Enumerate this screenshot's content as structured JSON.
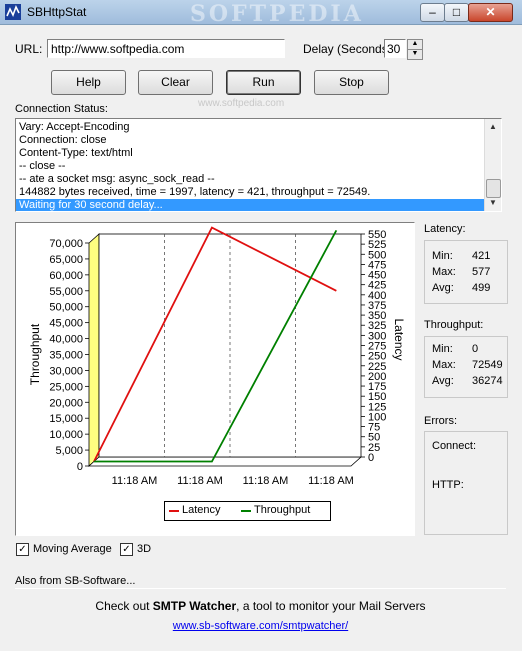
{
  "window": {
    "title": "SBHttpStat",
    "watermark": "SOFTPEDIA"
  },
  "url": {
    "label": "URL:",
    "value": "http://www.softpedia.com"
  },
  "delay": {
    "label": "Delay (Seconds):",
    "value": "30"
  },
  "buttons": {
    "help": "Help",
    "clear": "Clear",
    "run": "Run",
    "stop": "Stop"
  },
  "button_watermark": "www.softpedia.com",
  "connection": {
    "label": "Connection Status:",
    "lines": [
      "Vary: Accept-Encoding",
      "Connection: close",
      "Content-Type: text/html",
      "-- close --",
      "-- ate a socket msg: async_sock_read --",
      "144882 bytes received, time = 1997, latency = 421, throughput = 72549.",
      "Waiting for 30 second delay..."
    ]
  },
  "chart_data": {
    "type": "line",
    "x": [
      "11:18 AM",
      "11:18 AM",
      "11:18 AM",
      "11:18 AM"
    ],
    "y_left": {
      "label": "Throughput",
      "ticks": [
        0,
        5000,
        10000,
        15000,
        20000,
        25000,
        30000,
        35000,
        40000,
        45000,
        50000,
        55000,
        60000,
        65000,
        70000
      ],
      "tick_labels": [
        "0",
        "5,000",
        "10,000",
        "15,000",
        "20,000",
        "25,000",
        "30,000",
        "35,000",
        "40,000",
        "45,000",
        "50,000",
        "55,000",
        "60,000",
        "65,000",
        "70,000"
      ],
      "ylim": [
        0,
        70000
      ]
    },
    "y_right": {
      "label": "Latency",
      "ticks": [
        0,
        25,
        50,
        75,
        100,
        125,
        150,
        175,
        200,
        225,
        250,
        275,
        300,
        325,
        350,
        375,
        400,
        425,
        450,
        475,
        500,
        525,
        550
      ],
      "ylim": [
        0,
        550
      ]
    },
    "series": [
      {
        "name": "Latency",
        "axis": "right",
        "color": "#e01010",
        "points": [
          [
            0,
            0
          ],
          [
            1.8,
            577
          ],
          [
            3.7,
            421
          ]
        ]
      },
      {
        "name": "Throughput",
        "axis": "left",
        "color": "#008000",
        "points": [
          [
            0,
            0
          ],
          [
            1.8,
            0
          ],
          [
            3.7,
            72549
          ]
        ]
      }
    ],
    "legend": "bottom-center",
    "grid": "vertical-dashed",
    "three_d": true
  },
  "latency": {
    "label": "Latency:",
    "min_label": "Min:",
    "min": "421",
    "max_label": "Max:",
    "max": "577",
    "avg_label": "Avg:",
    "avg": "499"
  },
  "throughput": {
    "label": "Throughput:",
    "min_label": "Min:",
    "min": "0",
    "max_label": "Max:",
    "max": "72549",
    "avg_label": "Avg:",
    "avg": "36274"
  },
  "errors": {
    "label": "Errors:",
    "connect_label": "Connect:",
    "http_label": "HTTP:"
  },
  "options": {
    "moving_average": "Moving Average",
    "moving_average_checked": true,
    "three_d": "3D",
    "three_d_checked": true
  },
  "ad": {
    "heading": "Also from SB-Software...",
    "prefix": "Check out ",
    "product": "SMTP Watcher",
    "suffix": ", a tool to monitor your Mail Servers",
    "link": "www.sb-software.com/smtpwatcher/"
  }
}
